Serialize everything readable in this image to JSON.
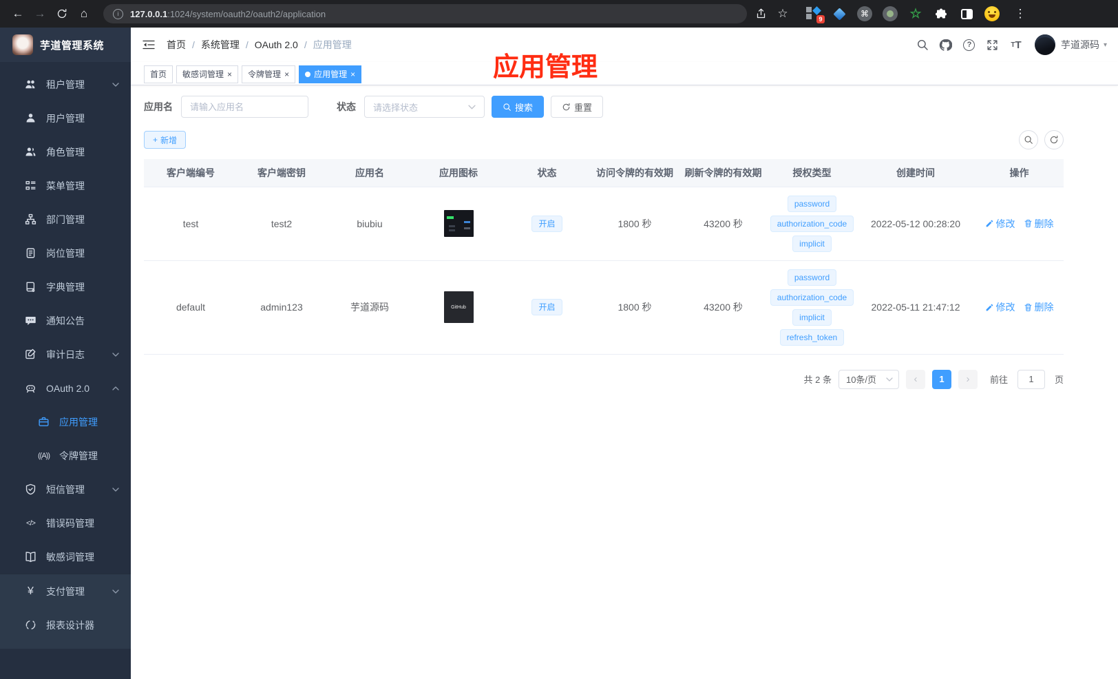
{
  "colors": {
    "accent": "#409eff",
    "sidebar_bg": "#252f40",
    "sidebar_lower_bg": "#2d3a4b",
    "overlay_red": "#ff2d12",
    "tag_bg": "#ecf5ff",
    "tag_border": "#d9ecff",
    "browser_bar_bg": "#202124",
    "active_tab_bg": "#409eff"
  },
  "icons": {
    "back": "←",
    "forward": "→",
    "home": "⌂",
    "star": "☆",
    "kebab": "⋮",
    "info": "i",
    "command": "⌘",
    "question": "?",
    "close": "×",
    "plus": "+",
    "caret_down": "▾",
    "prev": "‹",
    "next": "›",
    "font_small": "T",
    "font_big": "T",
    "token_glyph": "((A))",
    "yen": "¥",
    "code_glyph": "</>"
  },
  "browser": {
    "url_host": "127.0.0.1",
    "url_rest": ":1024/system/oauth2/oauth2/application",
    "extension_badge": "9"
  },
  "sidebar": {
    "title": "芋道管理系统",
    "items": [
      {
        "label": "租户管理",
        "icon": "tenant-users-icon"
      },
      {
        "label": "用户管理",
        "icon": "user-icon"
      },
      {
        "label": "角色管理",
        "icon": "role-users-icon"
      },
      {
        "label": "菜单管理",
        "icon": "menu-tree-icon"
      },
      {
        "label": "部门管理",
        "icon": "org-chart-icon"
      },
      {
        "label": "岗位管理",
        "icon": "post-badge-icon"
      },
      {
        "label": "字典管理",
        "icon": "dict-book-icon"
      },
      {
        "label": "通知公告",
        "icon": "notice-bubble-icon"
      },
      {
        "label": "审计日志",
        "icon": "audit-log-icon"
      },
      {
        "label": "OAuth 2.0",
        "icon": "robot-icon"
      },
      {
        "label": "应用管理",
        "icon": "briefcase-icon"
      },
      {
        "label": "令牌管理",
        "icon": "token-icon"
      },
      {
        "label": "短信管理",
        "icon": "shield-check-icon"
      },
      {
        "label": "错误码管理",
        "icon": "code-icon"
      },
      {
        "label": "敏感词管理",
        "icon": "open-book-icon"
      },
      {
        "label": "支付管理",
        "icon": "yen-icon"
      },
      {
        "label": "报表设计器",
        "icon": "report-circle-icon"
      }
    ]
  },
  "navbar": {
    "breadcrumb": [
      {
        "label": "首页"
      },
      {
        "label": "系统管理"
      },
      {
        "label": "OAuth 2.0"
      },
      {
        "label": "应用管理"
      }
    ],
    "username": "芋道源码"
  },
  "overlay_title": "应用管理",
  "tags": [
    {
      "label": "首页"
    },
    {
      "label": "敏感词管理"
    },
    {
      "label": "令牌管理"
    },
    {
      "label": "应用管理"
    }
  ],
  "filter": {
    "name_label": "应用名",
    "name_placeholder": "请输入应用名",
    "status_label": "状态",
    "status_placeholder": "请选择状态",
    "search_label": "搜索",
    "reset_label": "重置"
  },
  "toolbar": {
    "add_label": "新增"
  },
  "table": {
    "columns": [
      "客户端编号",
      "客户端密钥",
      "应用名",
      "应用图标",
      "状态",
      "访问令牌的有效期",
      "刷新令牌的有效期",
      "授权类型",
      "创建时间",
      "操作"
    ],
    "rows": [
      {
        "client_id": "test",
        "client_secret": "test2",
        "app_name": "biubiu",
        "app_icon": "dashboard-screenshot-thumbnail",
        "status": "开启",
        "access_token_ttl": "1800 秒",
        "refresh_token_ttl": "43200 秒",
        "grants": [
          "password",
          "authorization_code",
          "implicit"
        ],
        "created_at": "2022-05-12 00:28:20"
      },
      {
        "client_id": "default",
        "client_secret": "admin123",
        "app_name": "芋道源码",
        "app_icon": "GitHub",
        "status": "开启",
        "access_token_ttl": "1800 秒",
        "refresh_token_ttl": "43200 秒",
        "grants": [
          "password",
          "authorization_code",
          "implicit",
          "refresh_token"
        ],
        "created_at": "2022-05-11 21:47:12"
      }
    ],
    "edit_label": "修改",
    "delete_label": "删除"
  },
  "pagination": {
    "total": "共 2 条",
    "page_size": "10条/页",
    "current_page": "1",
    "goto_label": "前往",
    "goto_value": "1",
    "page_unit": "页"
  }
}
